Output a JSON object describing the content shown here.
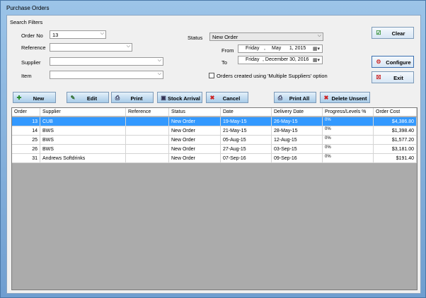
{
  "window": {
    "title": "Purchase Orders"
  },
  "filters": {
    "group_label": "Search Filters",
    "order_no_label": "Order No",
    "order_no_value": "13",
    "reference_label": "Reference",
    "reference_value": "",
    "supplier_label": "Supplier",
    "supplier_value": "",
    "item_label": "Item",
    "item_value": "",
    "status_label": "Status",
    "status_value": "New Order",
    "from_label": "From",
    "from_day": "Friday",
    "from_sep": ",",
    "from_date": "May      1, 2015",
    "to_label": "To",
    "to_day": "Friday",
    "to_date": ", December 30, 2016",
    "multi_supplier_label": "Orders created using 'Multiple Suppliers' option"
  },
  "side_buttons": {
    "clear": "Clear",
    "configure": "Configure",
    "exit": "Exit"
  },
  "toolbar": {
    "new": "New",
    "edit": "Edit",
    "print": "Print",
    "stock_arrival": "Stock Arrival",
    "cancel": "Cancel",
    "print_all": "Print All",
    "delete_unsent": "Delete Unsent"
  },
  "grid": {
    "columns": [
      "Order",
      "Supplier",
      "Reference",
      "Status",
      "Date",
      "Delivery Date",
      "Progress/Levels %",
      "Order Cost"
    ],
    "rows": [
      {
        "order": "13",
        "supplier": "CUB",
        "reference": "",
        "status": "New Order",
        "date": "19-May-15",
        "delivery": "26-May-15",
        "progress": "0%",
        "cost": "$4,386.80"
      },
      {
        "order": "14",
        "supplier": "BWS",
        "reference": "",
        "status": "New Order",
        "date": "21-May-15",
        "delivery": "28-May-15",
        "progress": "0%",
        "cost": "$1,398.40"
      },
      {
        "order": "25",
        "supplier": "BWS",
        "reference": "",
        "status": "New Order",
        "date": "05-Aug-15",
        "delivery": "12-Aug-15",
        "progress": "0%",
        "cost": "$1,577.20"
      },
      {
        "order": "26",
        "supplier": "BWS",
        "reference": "",
        "status": "New Order",
        "date": "27-Aug-15",
        "delivery": "03-Sep-15",
        "progress": "0%",
        "cost": "$3,181.00"
      },
      {
        "order": "31",
        "supplier": "Andrews Softdrinks",
        "reference": "",
        "status": "New Order",
        "date": "07-Sep-16",
        "delivery": "09-Sep-16",
        "progress": "0%",
        "cost": "$191.40"
      }
    ]
  }
}
